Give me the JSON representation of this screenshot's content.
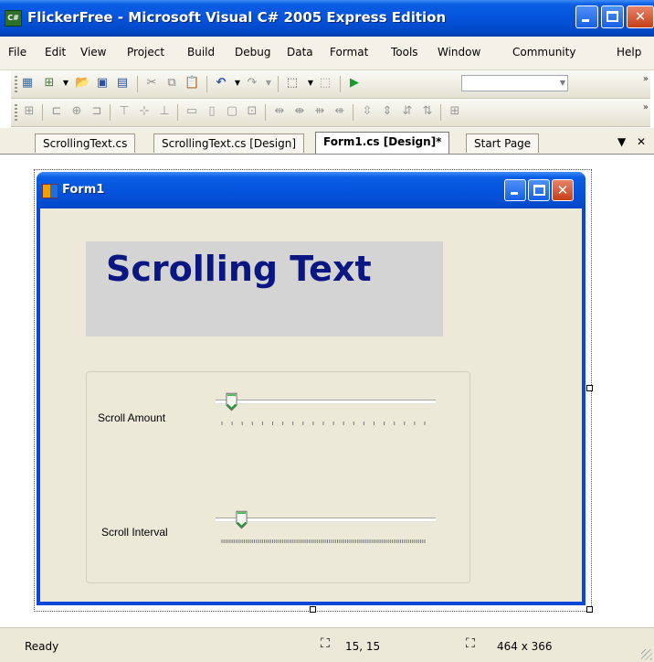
{
  "window": {
    "title": "FlickerFree - Microsoft Visual C# 2005 Express Edition",
    "app_icon": "C#"
  },
  "menu": [
    "File",
    "Edit",
    "View",
    "Project",
    "Build",
    "Debug",
    "Data",
    "Format",
    "Tools",
    "Window",
    "Community",
    "Help"
  ],
  "toolbar1": {
    "icons": [
      "new-project-icon",
      "add-item-icon",
      "open-file-icon",
      "save-icon",
      "save-all-icon",
      "cut-icon",
      "copy-icon",
      "paste-icon",
      "undo-icon",
      "redo-icon",
      "navigate-icon",
      "navigate-forward-icon",
      "start-debugging-icon"
    ],
    "config_value": ""
  },
  "toolbar2": {
    "icons": [
      "align-lefts-icon",
      "align-centers-icon",
      "align-rights-icon",
      "align-tops-icon",
      "align-middles-icon",
      "align-bottoms-icon",
      "make-same-width-icon",
      "make-same-height-icon",
      "make-same-size-icon",
      "size-to-grid-icon",
      "horizontal-spacing-equal-icon",
      "horizontal-spacing-increase-icon",
      "horizontal-spacing-decrease-icon",
      "horizontal-spacing-remove-icon",
      "vertical-spacing-equal-icon",
      "vertical-spacing-increase-icon",
      "vertical-spacing-decrease-icon",
      "vertical-spacing-remove-icon",
      "center-horizontally-icon"
    ]
  },
  "tabs": [
    {
      "label": "ScrollingText.cs",
      "active": false
    },
    {
      "label": "ScrollingText.cs [Design]",
      "active": false
    },
    {
      "label": "Form1.cs [Design]*",
      "active": true
    },
    {
      "label": "Start Page",
      "active": false
    }
  ],
  "tab_controls": {
    "dropdown": "▼",
    "close": "✕"
  },
  "form": {
    "title": "Form1",
    "banner_text": "Scrolling Text",
    "scroll_amount": {
      "label": "Scroll Amount",
      "value": 1,
      "min": 0,
      "max": 20
    },
    "scroll_interval": {
      "label": "Scroll Interval",
      "value": 10,
      "min": 0,
      "max": 100
    }
  },
  "status": {
    "text": "Ready",
    "position": "15, 15",
    "size": "464 x 366"
  },
  "colors": {
    "titlebar": "#0553dc",
    "banner_bg": "#d4d4d4",
    "banner_text": "#0a1682",
    "form_bg": "#ece9d8"
  }
}
